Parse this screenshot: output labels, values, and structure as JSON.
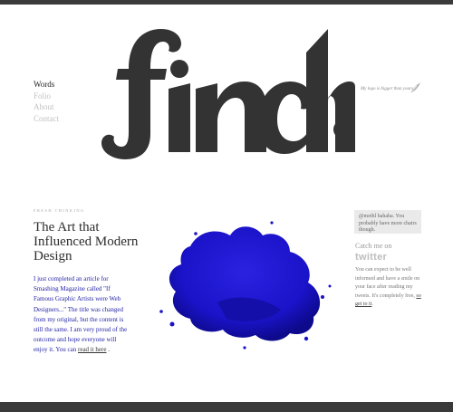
{
  "nav": {
    "items": [
      "Words",
      "Folio",
      "About",
      "Contact"
    ],
    "active": "Words"
  },
  "logo": {
    "text": "finch",
    "mark": "©"
  },
  "header": {
    "tagline": "My logo is bigger than yours"
  },
  "article": {
    "kicker": "FRESH THINKING",
    "title": "The Art that Influenced Modern Design",
    "body": "I just completed an article for Smashing Magazine called \"If Famous Graphic Artists were Web Designers...\" The title was changed from my original, but the content is still the same. I am very proud of the outcome and hope everyone will enjoy it. You can",
    "link": "read it here",
    "end": "."
  },
  "sidebar": {
    "tweet": "@methl hahaha. You probably have more chairs though.",
    "catch_label": "Catch me on",
    "twitter_logo": "twitter",
    "info": "You can expect to be well informed and have a smile on your face after reading my tweets. It's completely free,",
    "info_link": "so get to it",
    "info_end": "."
  },
  "colors": {
    "accent_blue": "#2424a8",
    "pigment": "#1a13c9",
    "bar": "#3a3a3a"
  }
}
